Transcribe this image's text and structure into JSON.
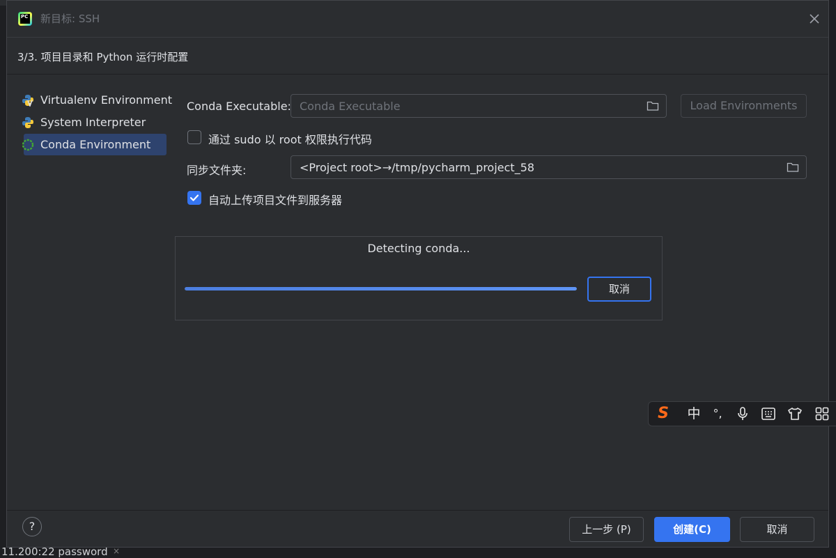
{
  "window": {
    "title": "新目标: SSH",
    "close_icon": "close-icon"
  },
  "step": {
    "title": "3/3. 项目目录和 Python 运行时配置"
  },
  "sidebar": {
    "items": [
      {
        "label": "Virtualenv Environment",
        "icon": "virtualenv-icon",
        "selected": false
      },
      {
        "label": "System Interpreter",
        "icon": "python-icon",
        "selected": false
      },
      {
        "label": "Conda Environment",
        "icon": "conda-icon",
        "selected": true
      }
    ]
  },
  "form": {
    "conda_label": "Conda Executable:",
    "conda_placeholder": "Conda Executable",
    "load_env_label": "Load Environments",
    "sudo_label": "通过 sudo 以 root 权限执行代码",
    "sudo_checked": false,
    "sync_label": "同步文件夹:",
    "sync_value": "<Project root>→/tmp/pycharm_project_58",
    "autoupload_label": "自动上传项目文件到服务器",
    "autoupload_checked": true
  },
  "progress": {
    "text": "Detecting conda...",
    "fraction": 1.0,
    "cancel_label": "取消"
  },
  "footer": {
    "help_label": "?",
    "back_label": "上一步 (P)",
    "create_label": "创建(C)",
    "cancel_label": "取消"
  },
  "ime": {
    "logo": "S",
    "mode": "中",
    "punct": "°,",
    "items": [
      "mic-icon",
      "keyboard-icon",
      "skin-icon",
      "apps-icon"
    ]
  },
  "background": {
    "bottom_text": "11.200:22 password",
    "bottom_close": "×"
  },
  "colors": {
    "accent": "#3574f0",
    "dialog_bg": "#2b2d30",
    "selected_bg": "#2e436e"
  }
}
